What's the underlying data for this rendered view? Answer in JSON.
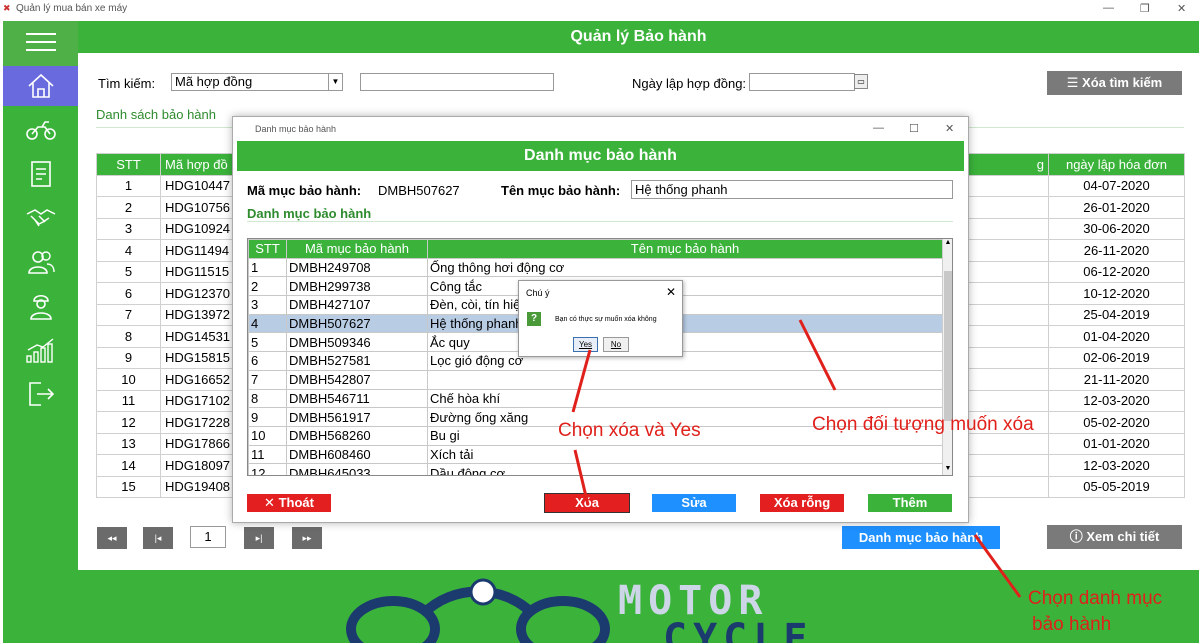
{
  "window": {
    "title": "Quản lý mua bán xe máy"
  },
  "header": {
    "title": "Quản lý Bảo hành"
  },
  "sidebar": {
    "items": [
      "home-icon",
      "motorbike-icon",
      "invoice-icon",
      "handshake-icon",
      "customers-icon",
      "employee-icon",
      "chart-icon",
      "logout-icon"
    ]
  },
  "search": {
    "label": "Tìm kiếm:",
    "combo_value": "Mã hợp đồng",
    "date_label": "Ngày lập hợp đồng:",
    "clear_label": "Xóa tìm kiếm"
  },
  "list": {
    "title": "Danh sách bảo hành",
    "col_stt": "STT",
    "col_code": "Mã hợp đồ",
    "col_g": "g",
    "col_date": "ngày lập hóa đơn",
    "rows": [
      {
        "stt": "1",
        "code": "HDG10447",
        "date": "04-07-2020"
      },
      {
        "stt": "2",
        "code": "HDG10756",
        "date": "26-01-2020"
      },
      {
        "stt": "3",
        "code": "HDG10924",
        "date": "30-06-2020"
      },
      {
        "stt": "4",
        "code": "HDG11494",
        "date": "26-11-2020"
      },
      {
        "stt": "5",
        "code": "HDG11515",
        "date": "06-12-2020"
      },
      {
        "stt": "6",
        "code": "HDG12370",
        "date": "10-12-2020"
      },
      {
        "stt": "7",
        "code": "HDG13972",
        "date": "25-04-2019"
      },
      {
        "stt": "8",
        "code": "HDG14531",
        "date": "01-04-2020"
      },
      {
        "stt": "9",
        "code": "HDG15815",
        "date": "02-06-2019"
      },
      {
        "stt": "10",
        "code": "HDG16652",
        "date": "21-11-2020"
      },
      {
        "stt": "11",
        "code": "HDG17102",
        "date": "12-03-2020"
      },
      {
        "stt": "12",
        "code": "HDG17228",
        "date": "05-02-2020"
      },
      {
        "stt": "13",
        "code": "HDG17866",
        "date": "01-01-2020"
      },
      {
        "stt": "14",
        "code": "HDG18097",
        "date": "12-03-2020"
      },
      {
        "stt": "15",
        "code": "HDG19408",
        "date": "05-05-2019"
      }
    ]
  },
  "pager": {
    "page": "1",
    "first": "◂◂",
    "prev": "|◂",
    "next": "▸|",
    "last": "▸▸"
  },
  "actions": {
    "catalog": "Danh mục bảo hành",
    "detail": "Xem chi tiết"
  },
  "dialog": {
    "window_title": "Danh mục bảo hành",
    "header": "Danh mục bảo hành",
    "code_label": "Mã mục bảo hành:",
    "code_value": "DMBH507627",
    "name_label": "Tên mục bảo hành:",
    "name_value": "Hệ thống phanh",
    "section": "Danh mục bảo hành",
    "col_stt": "STT",
    "col_code": "Mã mục bảo hành",
    "col_name": "Tên mục bảo hành",
    "rows": [
      {
        "stt": "1",
        "code": "DMBH249708",
        "name": "Ống thông hơi động cơ"
      },
      {
        "stt": "2",
        "code": "DMBH299738",
        "name": "Công tắc"
      },
      {
        "stt": "3",
        "code": "DMBH427107",
        "name": "Đèn, còi, tín hiệu"
      },
      {
        "stt": "4",
        "code": "DMBH507627",
        "name": "Hệ thống phanh"
      },
      {
        "stt": "5",
        "code": "DMBH509346",
        "name": "Ắc quy"
      },
      {
        "stt": "6",
        "code": "DMBH527581",
        "name": "Lọc gió động cơ"
      },
      {
        "stt": "7",
        "code": "DMBH542807",
        "name": ""
      },
      {
        "stt": "8",
        "code": "DMBH546711",
        "name": "Chế hòa khí"
      },
      {
        "stt": "9",
        "code": "DMBH561917",
        "name": "Đường ống xăng"
      },
      {
        "stt": "10",
        "code": "DMBH568260",
        "name": "Bu gi"
      },
      {
        "stt": "11",
        "code": "DMBH608460",
        "name": "Xích tải"
      },
      {
        "stt": "12",
        "code": "DMBH645033",
        "name": "Dầu động cơ"
      }
    ],
    "btn_exit": "Thoát",
    "btn_delete": "Xóa",
    "btn_edit": "Sửa",
    "btn_clear": "Xóa rỗng",
    "btn_add": "Thêm"
  },
  "confirm": {
    "title": "Chú ý",
    "message": "Bạn có thực sự muốn xóa không",
    "yes": "Yes",
    "no": "No"
  },
  "annotations": {
    "delete_yes": "Chọn xóa và Yes",
    "select_object": "Chọn đối tượng muốn xóa",
    "choose_catalog_1": "Chọn danh mục",
    "choose_catalog_2": "bảo hành"
  },
  "footer_logo": {
    "line1": "MOTOR",
    "line2": "CYCLE"
  },
  "colors": {
    "green": "#3bb33b",
    "red": "#e41f1f",
    "blue": "#1e90ff",
    "annotation": "#e0201b"
  }
}
